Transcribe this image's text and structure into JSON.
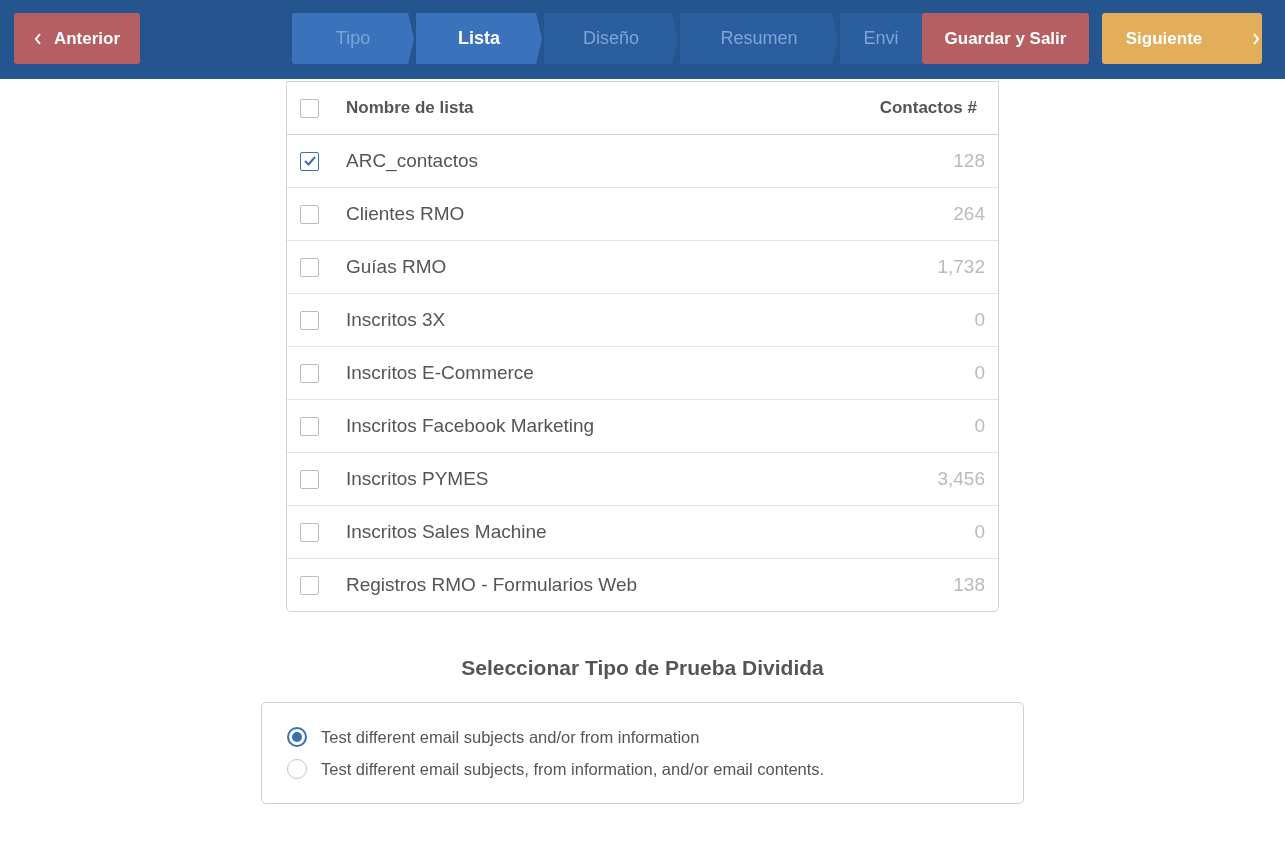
{
  "header": {
    "back_button": "Anterior",
    "steps": [
      {
        "label": "Tipo",
        "selected": false,
        "reached": true
      },
      {
        "label": "Lista",
        "selected": true,
        "reached": true
      },
      {
        "label": "Diseño",
        "selected": false,
        "reached": false
      },
      {
        "label": "Resumen",
        "selected": false,
        "reached": false
      },
      {
        "label": "Envi",
        "selected": false,
        "reached": false
      }
    ],
    "save_button": "Guardar y Salir",
    "next_button": "Siguiente"
  },
  "table": {
    "select_all": {
      "checked": false
    },
    "columns": [
      "Nombre de lista",
      "Contactos #"
    ],
    "rows": [
      {
        "name": "ARC_contactos",
        "count": "128",
        "checked": true
      },
      {
        "name": "Clientes RMO",
        "count": "264",
        "checked": false
      },
      {
        "name": "Guías RMO",
        "count": "1,732",
        "checked": false
      },
      {
        "name": "Inscritos 3X",
        "count": "0",
        "checked": false
      },
      {
        "name": "Inscritos E-Commerce",
        "count": "0",
        "checked": false
      },
      {
        "name": "Inscritos Facebook Marketing",
        "count": "0",
        "checked": false
      },
      {
        "name": "Inscritos PYMES",
        "count": "3,456",
        "checked": false
      },
      {
        "name": "Inscritos Sales Machine",
        "count": "0",
        "checked": false
      },
      {
        "name": "Registros RMO - Formularios Web",
        "count": "138",
        "checked": false
      }
    ]
  },
  "split_test": {
    "title": "Seleccionar Tipo de Prueba Dividida",
    "options": [
      {
        "label": "Test different email subjects and/or from information",
        "selected": true
      },
      {
        "label": "Test different email subjects, from information, and/or email contents.",
        "selected": false
      }
    ]
  }
}
